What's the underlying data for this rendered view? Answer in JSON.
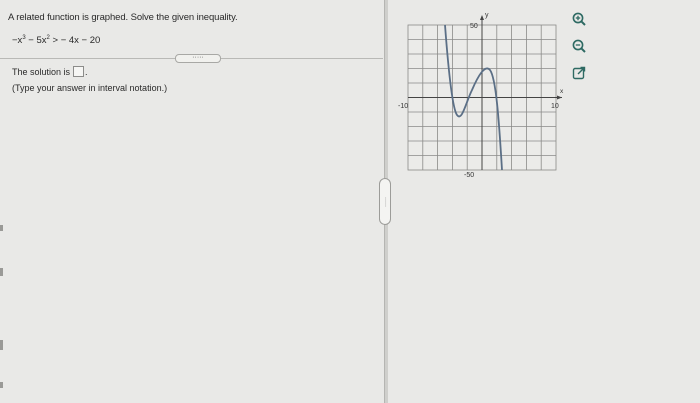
{
  "question": {
    "prompt": "A related function is graphed. Solve the given inequality.",
    "ineq_part1": "−x",
    "ineq_exp1": "3",
    "ineq_part2": " − 5x",
    "ineq_exp2": "2",
    "ineq_part3": " > − 4x − 20"
  },
  "more_button": "·····",
  "answer": {
    "label": "The solution is",
    "trailing": ".",
    "hint": "(Type your answer in interval notation.)"
  },
  "graph": {
    "y_axis_label": "y",
    "x_axis_label": "x",
    "y_max_label": "50",
    "y_min_label": "-50",
    "x_min_label": "-10",
    "x_max_label": "10"
  },
  "splitter_grip": "·····",
  "tools": {
    "zoom_in_icon": "magnifier-plus-icon",
    "zoom_out_icon": "magnifier-minus-icon",
    "popout_icon": "external-link-icon"
  },
  "colors": {
    "background": "#e9e9e7",
    "curve": "#5b6f86",
    "accent": "#2e6a63"
  }
}
